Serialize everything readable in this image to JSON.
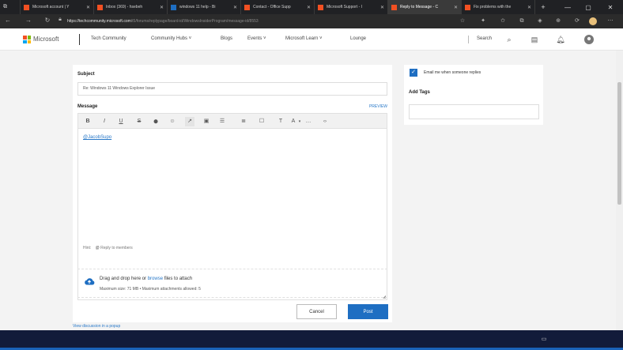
{
  "browser": {
    "tabs": [
      {
        "title": "Microsoft account | Y",
        "favicon_color": "#f25022",
        "active": false
      },
      {
        "title": "Inbox (369) - hsebeh",
        "favicon_color": "#f25022",
        "active": false
      },
      {
        "title": "windows 11 help - Bi",
        "favicon_color": "#1e6ec2",
        "active": false
      },
      {
        "title": "Contact - Office Supp",
        "favicon_color": "#f25022",
        "active": false
      },
      {
        "title": "Microsoft Support - I",
        "favicon_color": "#f25022",
        "active": false
      },
      {
        "title": "Reply to Message - C",
        "favicon_color": "#f25022",
        "active": true
      },
      {
        "title": "Fix problems with the",
        "favicon_color": "#f25022",
        "active": false
      }
    ],
    "new_tab_label": "+",
    "url_host": "https://techcommunity.microsoft.com",
    "url_path": "/t5/forums/replypage/board-id/WindowsInsiderProgram/message-id/8553"
  },
  "site": {
    "brand": "Microsoft",
    "section": "Tech Community",
    "nav": [
      "Community Hubs ˅",
      "Blogs",
      "Events ˅",
      "Microsoft Learn ˅",
      "Lounge"
    ],
    "search_label": "Search"
  },
  "form": {
    "subject_label": "Subject",
    "subject_value": "Re: Windows 11 Windows Explorer Issue",
    "message_label": "Message",
    "preview_label": "PREVIEW",
    "toolbar_icons": [
      "B",
      "I",
      "U",
      "S",
      "⬤",
      "☺",
      "↗",
      "▣",
      "☰",
      "≣",
      "☐",
      "T",
      "A",
      "▾",
      "…",
      "‹›"
    ],
    "mention": "@JacobSupo",
    "hint_prefix": "Hint:",
    "hint_text": "Reply to members",
    "drop_text_before": "Drag and drop here or ",
    "drop_text_link": "browse",
    "drop_text_after": " files to attach",
    "drop_limits": "Maximum size: 71 MB • Maximum attachments allowed: 5",
    "cancel_label": "Cancel",
    "post_label": "Post",
    "popup_link": "View discussion in a popup"
  },
  "sidebar": {
    "email_me_label": "Email me when someone replies",
    "email_me_checked": true,
    "tags_label": "Add Tags"
  },
  "colors": {
    "accent": "#1e6ec2",
    "link": "#2878c8",
    "taskbar": "#121b3a"
  }
}
